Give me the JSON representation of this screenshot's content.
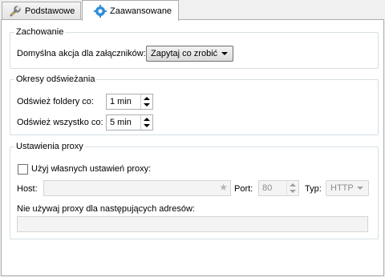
{
  "tabs": [
    {
      "label": "Podstawowe",
      "icon": "wrench-icon",
      "active": false
    },
    {
      "label": "Zaawansowane",
      "icon": "gear-icon",
      "active": true
    }
  ],
  "behavior": {
    "title": "Zachowanie",
    "attachment_label": "Domyślna akcja dla załączników:",
    "attachment_value": "Zapytaj co zrobić"
  },
  "refresh": {
    "title": "Okresy odświeżania",
    "folders_label": "Odśwież foldery co:",
    "folders_value": "1 min",
    "all_label": "Odśwież wszystko co:",
    "all_value": "5 min"
  },
  "proxy": {
    "title": "Ustawienia proxy",
    "use_own_label": "Użyj własnych ustawień proxy:",
    "use_own_checked": false,
    "host_label": "Host:",
    "host_value": "",
    "port_label": "Port:",
    "port_value": "80",
    "type_label": "Typ:",
    "type_value": "HTTP",
    "exclusions_label": "Nie używaj proxy dla następujących adresów:",
    "exclusions_value": ""
  }
}
